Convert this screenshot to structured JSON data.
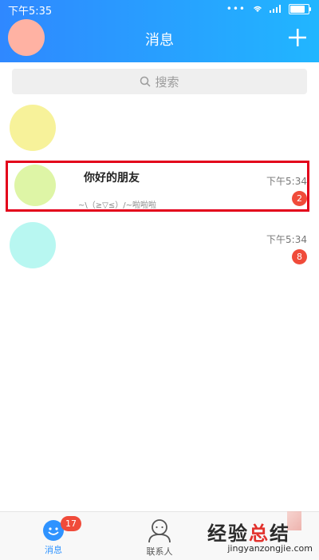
{
  "status_bar": {
    "time": "下午5:35"
  },
  "header": {
    "title": "消息"
  },
  "search": {
    "placeholder": "搜索"
  },
  "conversations": [
    {
      "avatar_color": "#f7f29a",
      "name": "",
      "preview": "",
      "time": "",
      "badge": ""
    },
    {
      "avatar_color": "#def5a6",
      "name": "你好的朋友",
      "preview": "~\\（≥▽≤）/~啦啦啦",
      "time": "下午5:34",
      "badge": "2"
    },
    {
      "avatar_color": "#b8f7f1",
      "name": "",
      "preview": "",
      "time": "下午5:34",
      "badge": "8"
    }
  ],
  "bottom_nav": {
    "messages_label": "消息",
    "messages_badge": "17",
    "contacts_label": "联系人"
  },
  "watermark": {
    "text": "经验总结",
    "url": "jingyanzongjie.com"
  },
  "colors": {
    "header_start": "#2f88ff",
    "header_end": "#21b6ff",
    "badge": "#f04b3a",
    "highlight": "#e3001b"
  }
}
